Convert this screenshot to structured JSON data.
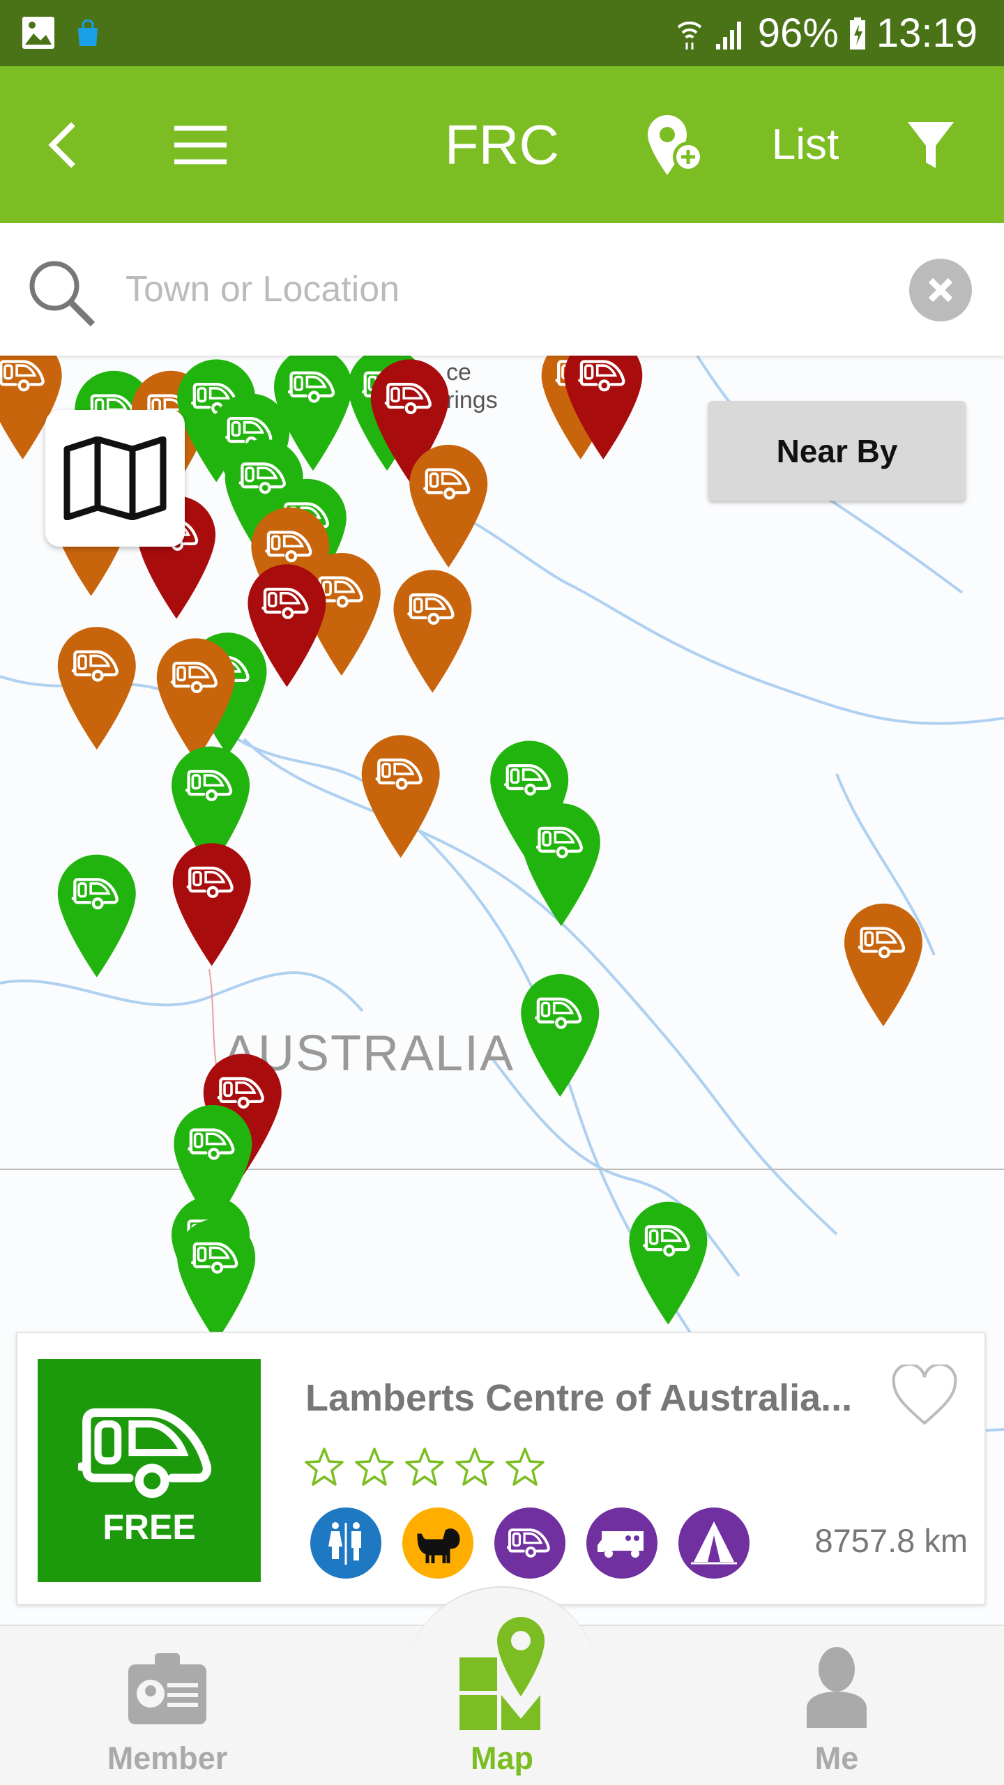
{
  "status_bar": {
    "battery": "96%",
    "time": "13:19",
    "icons": [
      "gallery-icon",
      "shopping-bag-icon",
      "wifi-icon",
      "signal-icon",
      "battery-charging-icon"
    ]
  },
  "header": {
    "title": "FRC",
    "list_label": "List",
    "icons": [
      "back-icon",
      "menu-icon",
      "add-location-icon",
      "filter-icon"
    ]
  },
  "search": {
    "placeholder": "Town or Location",
    "value": ""
  },
  "map": {
    "labels": {
      "country": "AUSTRALIA",
      "town_partial": "ce\nrings"
    },
    "near_by_label": "Near By",
    "pin_colors": {
      "green": "#22b40e",
      "orange": "#c8650c",
      "red": "#a80c0c"
    }
  },
  "card": {
    "thumb_label": "FREE",
    "title": "Lamberts Centre of Australia...",
    "rating": 0,
    "rating_max": 5,
    "amenities": [
      {
        "icon": "toilets-icon",
        "color": "#1e78c2"
      },
      {
        "icon": "pet-friendly-icon",
        "color": "#ffae00"
      },
      {
        "icon": "caravan-icon",
        "color": "#7030a0"
      },
      {
        "icon": "motorhome-icon",
        "color": "#7030a0"
      },
      {
        "icon": "tent-icon",
        "color": "#7030a0"
      }
    ],
    "distance": "8757.8 km"
  },
  "nav": {
    "items": [
      {
        "label": "Member"
      },
      {
        "label": "Map",
        "active": true
      },
      {
        "label": "Me"
      }
    ]
  },
  "colors": {
    "brand": "#7bbd22",
    "status_bar": "#4a7317",
    "inactive": "#aaaaaa"
  }
}
